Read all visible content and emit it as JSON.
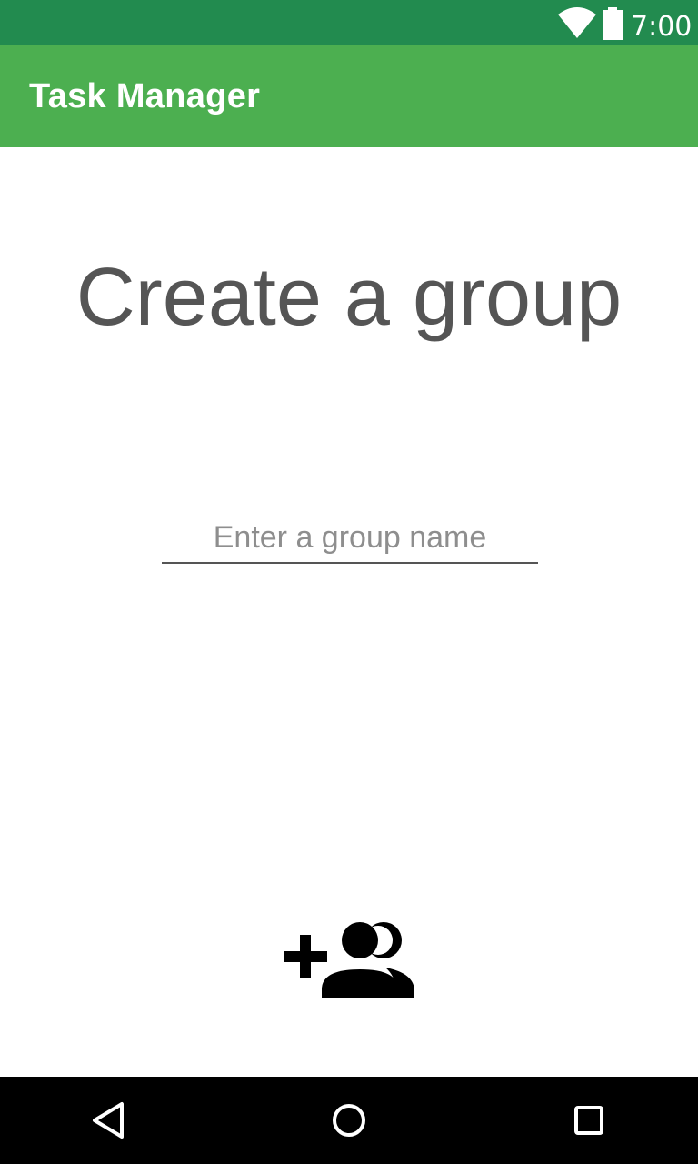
{
  "status_bar": {
    "time": "7:00",
    "icons": [
      "wifi-icon",
      "battery-icon"
    ]
  },
  "app_bar": {
    "title": "Task Manager"
  },
  "main": {
    "heading": "Create a group",
    "group_name_input": {
      "value": "",
      "placeholder": "Enter a group name"
    },
    "add_group_button": {
      "icon": "group-add-icon"
    }
  },
  "nav_bar": {
    "icons": [
      "back-icon",
      "home-icon",
      "recents-icon"
    ]
  },
  "colors": {
    "status_bar": "#228b4f",
    "app_bar": "#4caf50",
    "heading_text": "#555555",
    "placeholder_text": "#8e8e8e",
    "nav_bar": "#000000"
  }
}
